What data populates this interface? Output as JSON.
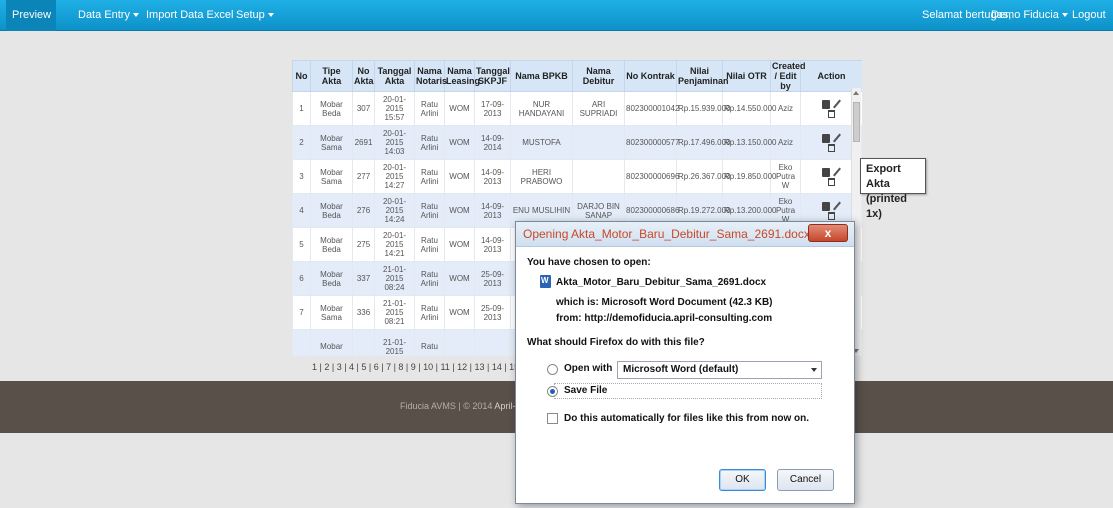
{
  "navbar": {
    "left": [
      "Preview",
      "Data Entry",
      "Import Data Excel",
      "Setup"
    ],
    "greeting": "Selamat bertugas,",
    "user": "Demo Fiducia",
    "logout": "Logout"
  },
  "table": {
    "headers": [
      "No",
      "Tipe Akta",
      "No Akta",
      "Tanggal Akta",
      "Nama Notaris",
      "Nama Leasing",
      "Tanggal SKPJF",
      "Nama BPKB",
      "Nama Debitur",
      "No Kontrak",
      "Nilai Penjaminan",
      "Nilai OTR",
      "Created / Edit by",
      "Action"
    ],
    "rows": [
      [
        "1",
        "Mobar Beda",
        "307",
        "20-01-2015 15:57",
        "Ratu Arlini",
        "WOM",
        "17-09-2013",
        "NUR HANDAYANI",
        "ARI SUPRIADI",
        "802300001042",
        "Rp.15.939.000",
        "Rp.14.550.000",
        "Aziz"
      ],
      [
        "2",
        "Mobar Sama",
        "2691",
        "20-01-2015 14:03",
        "Ratu Arlini",
        "WOM",
        "14-09-2014",
        "MUSTOFA",
        "",
        "802300000577",
        "Rp.17.496.000",
        "Rp.13.150.000",
        "Aziz"
      ],
      [
        "3",
        "Mobar Sama",
        "277",
        "20-01-2015 14:27",
        "Ratu Arlini",
        "WOM",
        "14-09-2013",
        "HERI PRABOWO",
        "",
        "802300000696",
        "Rp.26.367.000",
        "Rp.19.850.000",
        "Eko Putra W"
      ],
      [
        "4",
        "Mobar Beda",
        "276",
        "20-01-2015 14:24",
        "Ratu Arlini",
        "WOM",
        "14-09-2013",
        "ENU MUSLIHIN",
        "DARJO BIN SANAP",
        "802300000686",
        "Rp.19.272.000",
        "Rp.13.200.000",
        "Eko Putra W"
      ],
      [
        "5",
        "Mobar Beda",
        "275",
        "20-01-2015 14:21",
        "Ratu Arlini",
        "WOM",
        "14-09-2013",
        "",
        "",
        "",
        "",
        "",
        ""
      ],
      [
        "6",
        "Mobar Beda",
        "337",
        "21-01-2015 08:24",
        "Ratu Arlini",
        "WOM",
        "25-09-2013",
        "",
        "",
        "",
        "",
        "",
        ""
      ],
      [
        "7",
        "Mobar Sama",
        "336",
        "21-01-2015 08:21",
        "Ratu Arlini",
        "WOM",
        "25-09-2013",
        "",
        "",
        "",
        "",
        "",
        ""
      ],
      [
        "",
        "Mobar",
        "",
        "21-01-2015",
        "Ratu",
        "",
        "",
        "",
        "",
        "",
        "",
        "",
        ""
      ]
    ]
  },
  "pagination": "1 | 2 | 3 | 4 | 5 | 6 | 7 | 8 | 9 | 10 | 11 | 12 | 13 | 14 | 15 | 16 | 17",
  "tooltip": {
    "line1": "Export Akta",
    "line2": "(printed 1x)"
  },
  "footer": {
    "text": "Fiducia AVMS | © 2014 ",
    "brand": "April-Consulting"
  },
  "dialog": {
    "title": "Opening Akta_Motor_Baru_Debitur_Sama_2691.docx",
    "close": "x",
    "chosen": "You have chosen to open:",
    "filename": "Akta_Motor_Baru_Debitur_Sama_2691.docx",
    "which_is": "which is:  Microsoft Word Document (42.3 KB)",
    "from": "from:  http://demofiducia.april-consulting.com",
    "question": "What should Firefox do with this file?",
    "open_with": "Open with",
    "app": "Microsoft Word (default)",
    "save_file": "Save File",
    "auto": "Do this automatically for files like this from now on.",
    "ok": "OK",
    "cancel": "Cancel"
  }
}
